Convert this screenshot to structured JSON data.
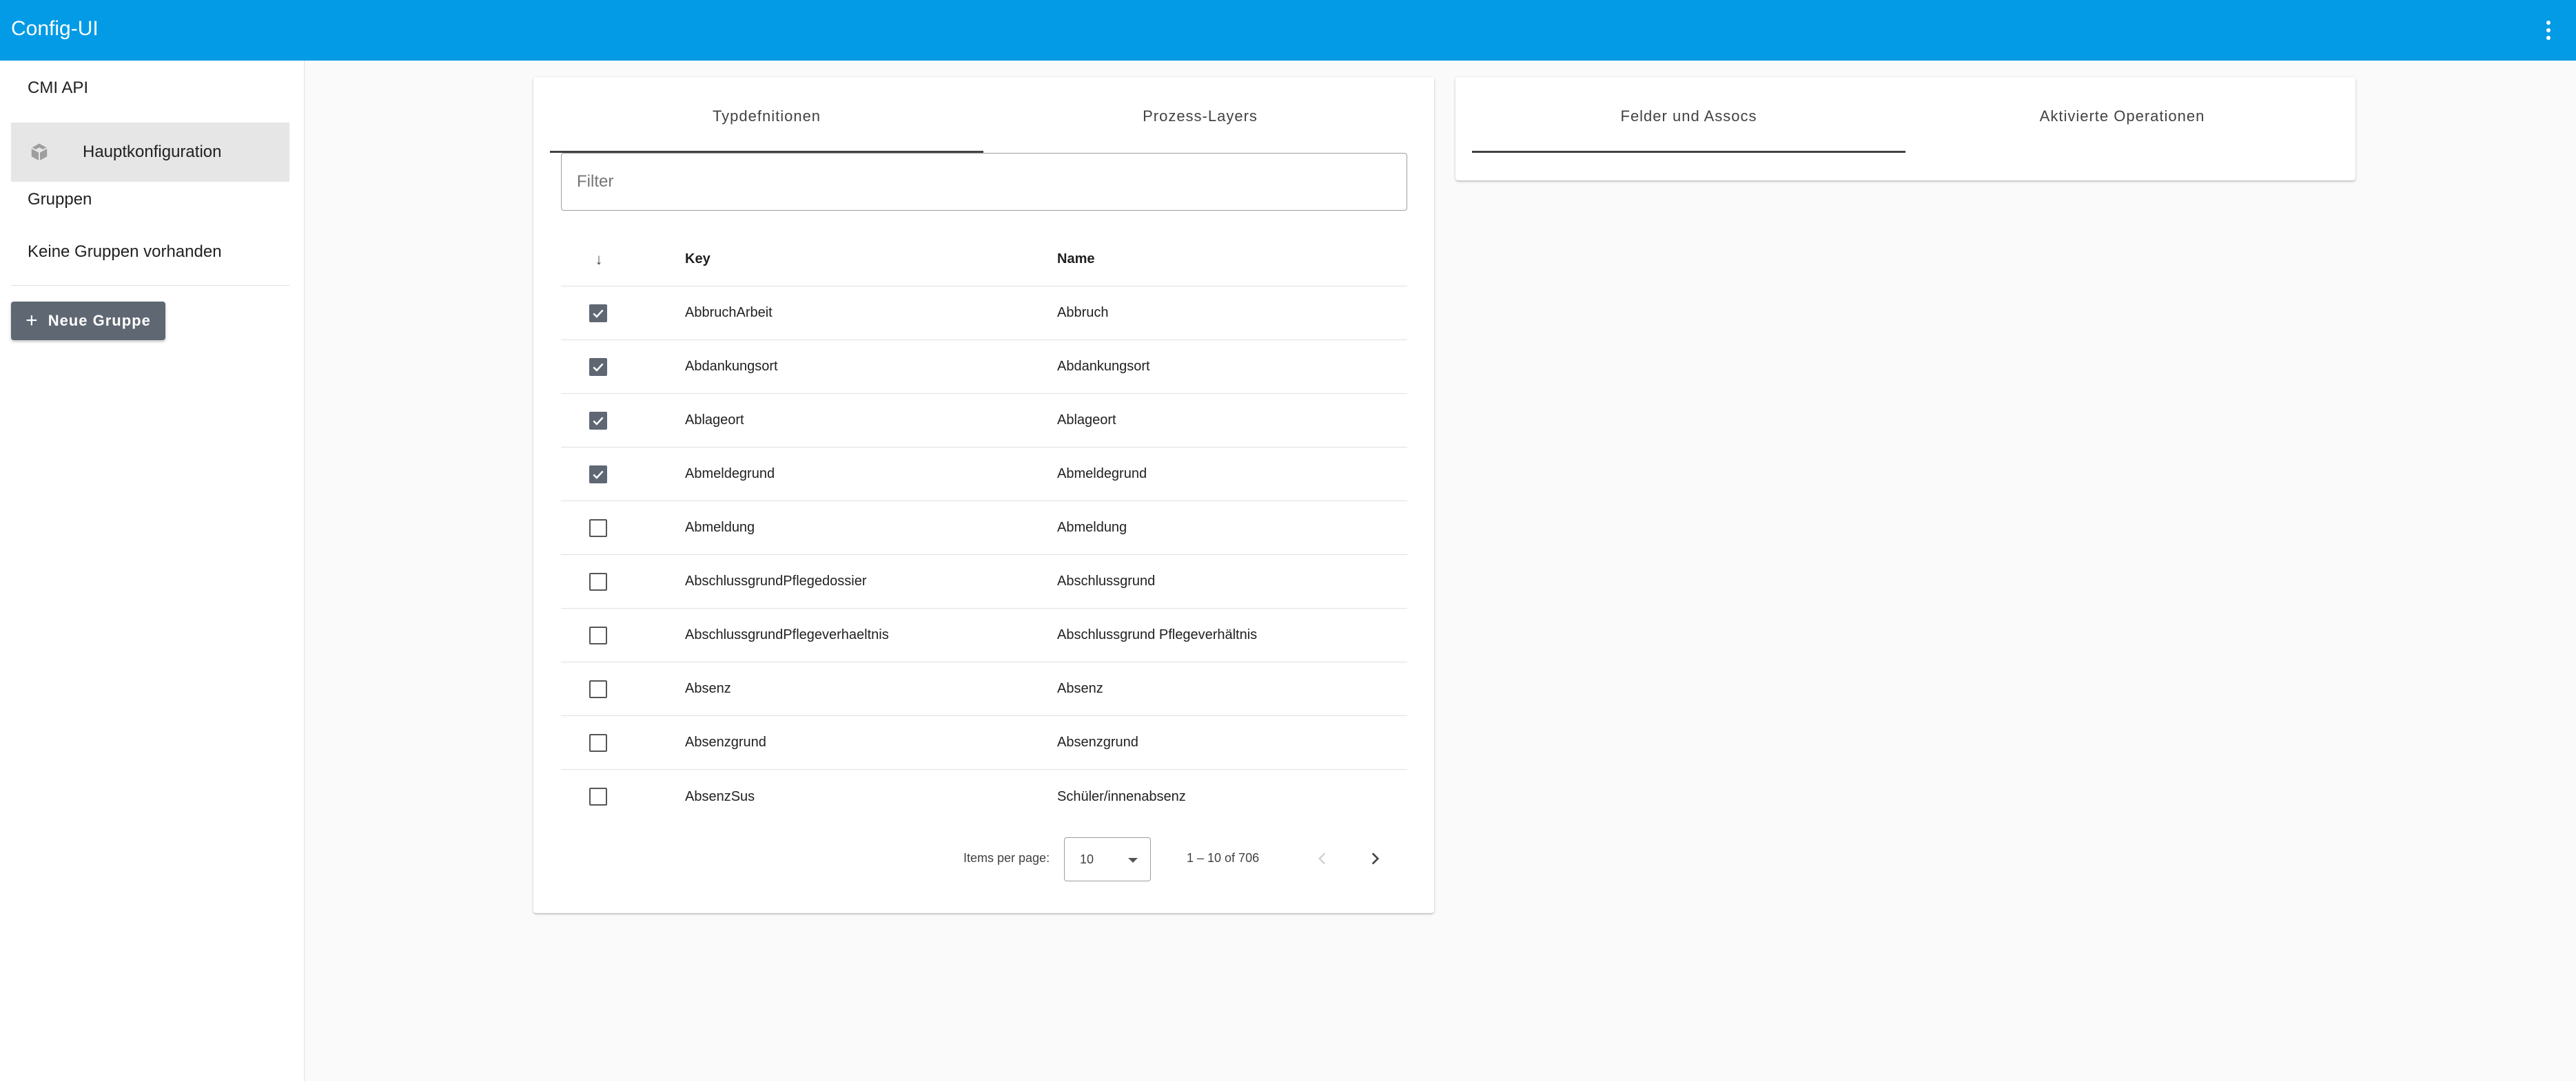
{
  "app": {
    "title": "Config-UI"
  },
  "sidebar": {
    "cmi_api": "CMI API",
    "main_config": "Hauptkonfiguration",
    "groups_heading": "Gruppen",
    "no_groups": "Keine Gruppen vorhanden",
    "new_group_button": "Neue Gruppe"
  },
  "left_card": {
    "tabs": [
      {
        "label": "Typdefnitionen",
        "active": true
      },
      {
        "label": "Prozess-Layers",
        "active": false
      }
    ],
    "filter": {
      "placeholder": "Filter",
      "value": ""
    },
    "table": {
      "columns": {
        "sort": "↓",
        "key": "Key",
        "name": "Name"
      },
      "rows": [
        {
          "checked": true,
          "key": "AbbruchArbeit",
          "name": "Abbruch"
        },
        {
          "checked": true,
          "key": "Abdankungsort",
          "name": "Abdankungsort"
        },
        {
          "checked": true,
          "key": "Ablageort",
          "name": "Ablageort"
        },
        {
          "checked": true,
          "key": "Abmeldegrund",
          "name": "Abmeldegrund"
        },
        {
          "checked": false,
          "key": "Abmeldung",
          "name": "Abmeldung"
        },
        {
          "checked": false,
          "key": "AbschlussgrundPflegedossier",
          "name": "Abschlussgrund"
        },
        {
          "checked": false,
          "key": "AbschlussgrundPflegeverhaeltnis",
          "name": "Abschlussgrund Pflegeverhältnis"
        },
        {
          "checked": false,
          "key": "Absenz",
          "name": "Absenz"
        },
        {
          "checked": false,
          "key": "Absenzgrund",
          "name": "Absenzgrund"
        },
        {
          "checked": false,
          "key": "AbsenzSus",
          "name": "Schüler/innenabsenz"
        }
      ]
    },
    "paginator": {
      "items_per_page_label": "Items per page:",
      "items_per_page_value": "10",
      "range_label": "1 – 10 of 706",
      "prev_disabled": true
    }
  },
  "right_card": {
    "tabs": [
      {
        "label": "Felder und Assocs",
        "active": true
      },
      {
        "label": "Aktivierte Operationen",
        "active": false
      }
    ]
  }
}
